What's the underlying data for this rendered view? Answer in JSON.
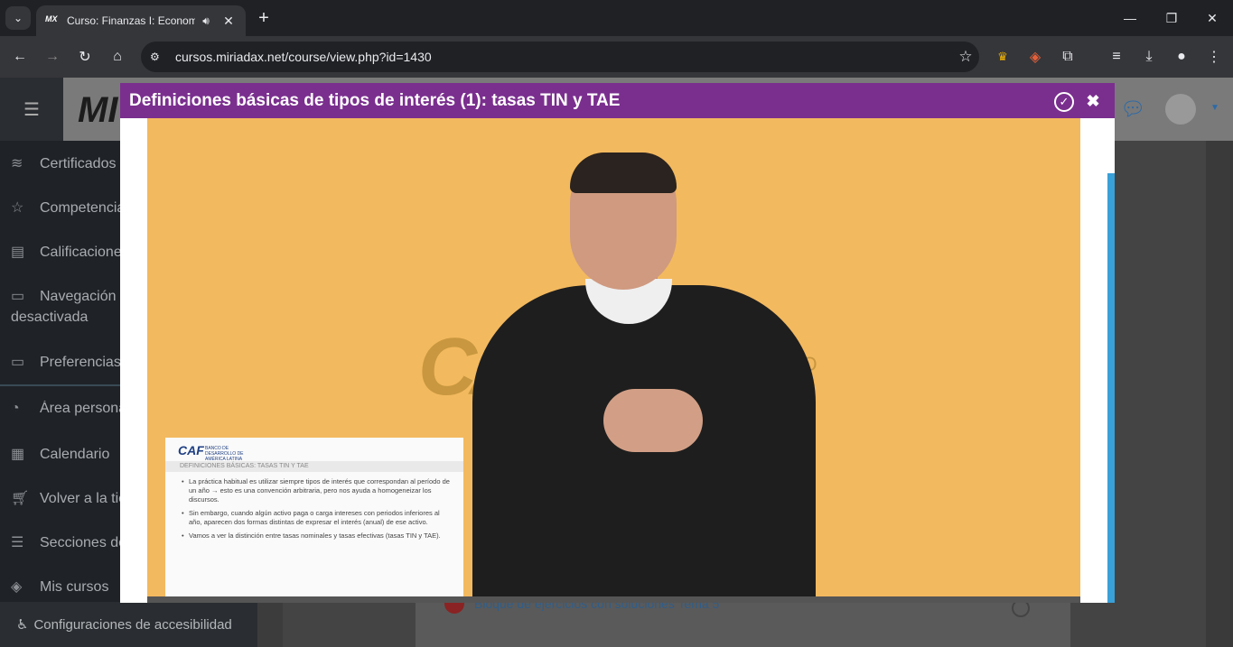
{
  "browser": {
    "tab_title": "Curso: Finanzas I: Economía",
    "tab_favicon": "MX",
    "url": "cursos.miriadax.net/course/view.php?id=1430"
  },
  "site": {
    "logo": "MI",
    "sidebar_items": [
      {
        "label": "Certificados",
        "icon": "layers-icon"
      },
      {
        "label": "Competencias",
        "icon": "star-icon"
      },
      {
        "label": "Calificaciones",
        "icon": "book-icon"
      },
      {
        "label": "Navegación",
        "label2": "desactivada",
        "icon": "folder-icon"
      },
      {
        "label": "Preferencias",
        "icon": "folder-icon"
      },
      {
        "label": "Área personal",
        "icon": "dashboard-icon"
      },
      {
        "label": "Calendario",
        "icon": "calendar-icon"
      },
      {
        "label": "Volver a la tienda",
        "icon": "cart-icon"
      },
      {
        "label": "Secciones del curso",
        "icon": "list-icon"
      },
      {
        "label": "Mis cursos",
        "icon": "graduation-icon"
      }
    ],
    "accessibility": "Configuraciones de accesibilidad",
    "card_link": "Bloque de ejercicios con soluciones Tema 5"
  },
  "modal": {
    "title": "Definiciones básicas de tipos de interés (1): tasas TIN y TAE"
  },
  "video": {
    "watermark": "CAF",
    "watermark_sub": "LLO",
    "slide": {
      "logo": "CAF",
      "logo_sub": "BANCO DE DESARROLLO DE AMÉRICA LATINA",
      "heading": "DEFINICIONES BÁSICAS: TASAS TIN Y TAE",
      "bullets": [
        "La práctica habitual es utilizar siempre tipos de interés que correspondan al período de un año → esto es una convención arbitraria, pero nos ayuda a homogeneizar los discursos.",
        "Sin embargo, cuando algún activo paga o carga intereses con periodos inferiores al año, aparecen dos formas distintas de expresar el interés (anual) de ese activo.",
        "Vamos a ver la distinción entre tasas nominales y tasas efectivas (tasas TIN y TAE)."
      ]
    }
  },
  "colors": {
    "modal_header": "#7a2f8e",
    "video_bg": "#f3b95f",
    "scrollbar": "#3aa0d8"
  }
}
